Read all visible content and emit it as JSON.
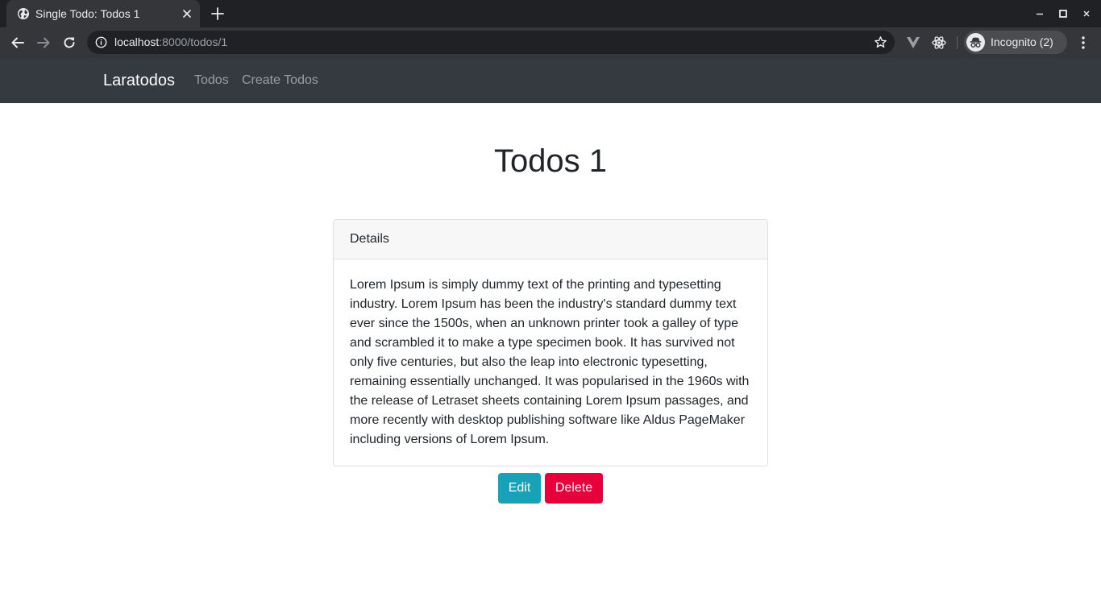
{
  "browser": {
    "tab_title": "Single Todo: Todos 1",
    "url_host": "localhost",
    "url_path": ":8000/todos/1",
    "profile_label": "Incognito (2)",
    "icons": [
      "globe-icon",
      "close-icon",
      "plus-icon",
      "minimize-icon",
      "maximize-icon",
      "back-arrow-icon",
      "forward-arrow-icon",
      "reload-icon",
      "info-icon",
      "star-icon",
      "vue-devtools-icon",
      "react-devtools-icon",
      "incognito-icon",
      "kebab-menu-icon"
    ]
  },
  "navbar": {
    "brand": "Laratodos",
    "links": [
      {
        "label": "Todos"
      },
      {
        "label": "Create Todos"
      }
    ],
    "background": "#343a40"
  },
  "page": {
    "title": "Todos 1",
    "card": {
      "header": "Details",
      "body": "Lorem Ipsum is simply dummy text of the printing and typesetting industry. Lorem Ipsum has been the industry's standard dummy text ever since the 1500s, when an unknown printer took a galley of type and scrambled it to make a type specimen book. It has survived not only five centuries, but also the leap into electronic typesetting, remaining essentially unchanged. It was popularised in the 1960s with the release of Letraset sheets containing Lorem Ipsum passages, and more recently with desktop publishing software like Aldus PageMaker including versions of Lorem Ipsum."
    },
    "buttons": {
      "edit_label": "Edit",
      "edit_color": "#17a2b8",
      "delete_label": "Delete",
      "delete_color": "#e8003a"
    }
  }
}
